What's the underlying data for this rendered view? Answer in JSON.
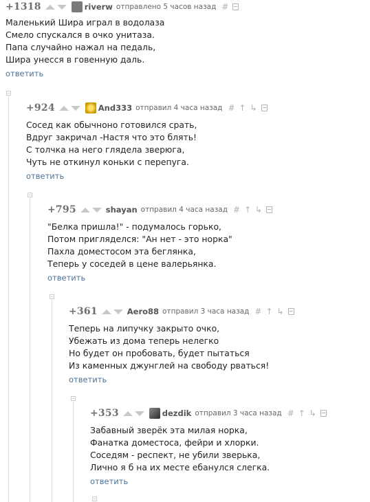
{
  "comments": [
    {
      "rating": "+1318",
      "user": "riverw",
      "meta": "отправлено 5 часов назад",
      "lines": [
        "Маленький Шира играл в водолаза",
        "Смело спускался в очко унитаза.",
        "Папа случайно нажал на педаль,",
        "Шира унесся в говенную даль."
      ],
      "reply": "ответить",
      "avatar_color": "#7a7a7a"
    },
    {
      "rating": "+924",
      "user": "And333",
      "meta": "отправил 4 часа назад",
      "lines": [
        "Сосед как обычноно готовился срать,",
        "Вдруг закричал -Настя что это блять!",
        "С толчка на него глядела зверюга,",
        "Чуть не откинул коньки с перепуга."
      ],
      "reply": "ответить",
      "avatar_color": "#c99a00"
    },
    {
      "rating": "+795",
      "user": "shayan",
      "meta": "отправил 4 часа назад",
      "lines": [
        "\"Белка пришла!\" - подумалось горько,",
        "Потом пригляделся: \"Ан нет - это норка\"",
        "Пахла доместосом эта беглянка,",
        "Теперь у соседей в цене валерьянка."
      ],
      "reply": "ответить"
    },
    {
      "rating": "+361",
      "user": "Aero88",
      "meta": "отправил 3 часа назад",
      "lines": [
        "Теперь на липучку закрыто очко,",
        "Убежать из дома теперь нелегко",
        "Но будет он пробовать, будет пытаться",
        "Из каменных джунглей на свободу рваться!"
      ],
      "reply": "ответить"
    },
    {
      "rating": "+353",
      "user": "dezdik",
      "meta": "отправил 3 часа назад",
      "lines": [
        "Забавный зверёк эта милая норка,",
        "Фанатка доместоса, фейри и хлорки.",
        "Соседям - респект, не убили зверька,",
        "Лично я б на их месте ебанулся слегка."
      ],
      "reply": "ответить",
      "avatar_color": "#3d3d3d"
    }
  ],
  "icon_glyphs": {
    "hash": "#",
    "up_arrow": "↑",
    "branch": "↳"
  },
  "colors": {
    "link": "#4c7399",
    "rating": "#6f6f6f",
    "icon": "#b2b2b2"
  }
}
